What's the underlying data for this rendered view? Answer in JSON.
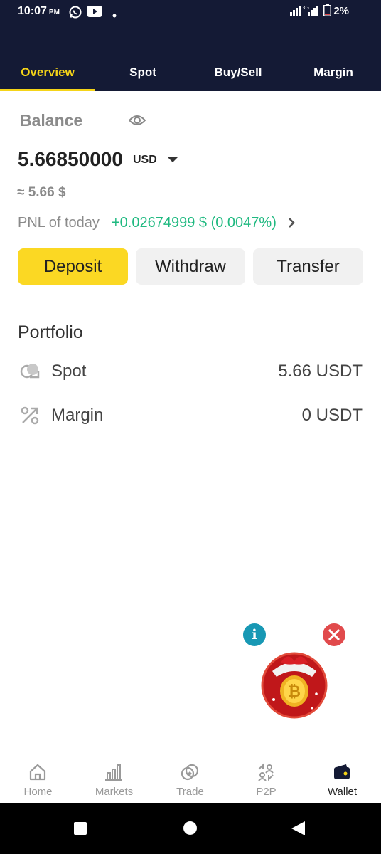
{
  "status_bar": {
    "time": "10:07",
    "ampm": "PM",
    "battery": "2%",
    "icons": [
      "whatsapp-icon",
      "youtube-icon",
      "dot-icon",
      "signal-icon",
      "signal-3g-icon",
      "battery-icon"
    ]
  },
  "tabs": [
    {
      "label": "Overview",
      "active": true
    },
    {
      "label": "Spot",
      "active": false
    },
    {
      "label": "Buy/Sell",
      "active": false
    },
    {
      "label": "Margin",
      "active": false
    }
  ],
  "balance": {
    "label": "Balance",
    "amount": "5.66850000",
    "currency": "USD",
    "approx": "≈ 5.66 $",
    "pnl_label": "PNL of today",
    "pnl_value": "+0.02674999 $ (0.0047%)"
  },
  "actions": {
    "deposit": "Deposit",
    "withdraw": "Withdraw",
    "transfer": "Transfer"
  },
  "portfolio": {
    "title": "Portfolio",
    "items": [
      {
        "label": "Spot",
        "value": "5.66 USDT",
        "icon": "spot-icon"
      },
      {
        "label": "Margin",
        "value": "0 USDT",
        "icon": "margin-icon"
      }
    ]
  },
  "widget": {
    "info": "i"
  },
  "bottom_nav": [
    {
      "label": "Home",
      "icon": "home-icon"
    },
    {
      "label": "Markets",
      "icon": "markets-icon"
    },
    {
      "label": "Trade",
      "icon": "trade-icon"
    },
    {
      "label": "P2P",
      "icon": "p2p-icon"
    },
    {
      "label": "Wallet",
      "icon": "wallet-icon",
      "active": true
    }
  ],
  "colors": {
    "header_bg": "#141a35",
    "accent_yellow": "#f5d418",
    "deposit_bg": "#fbd823",
    "pnl_green": "#1fb980",
    "info_teal": "#1898b4",
    "close_red": "#e14a4c"
  }
}
